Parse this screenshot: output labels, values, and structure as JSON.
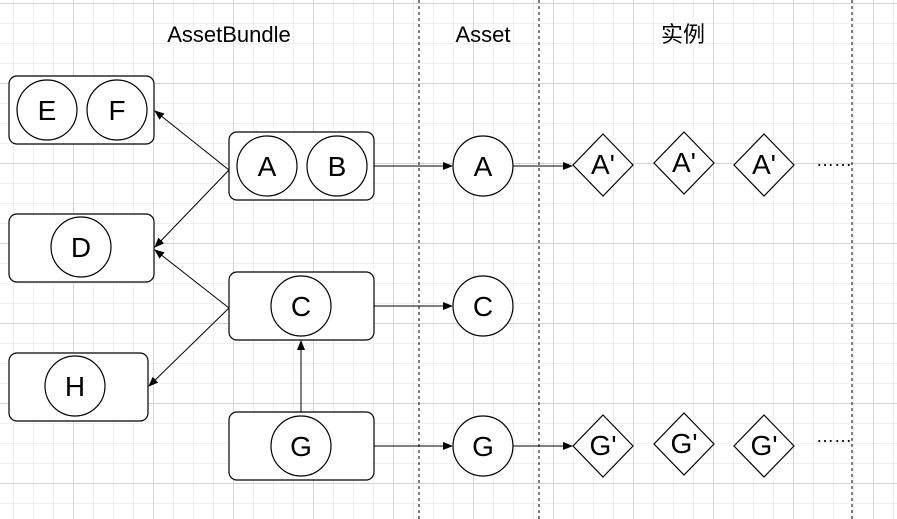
{
  "columns": {
    "assetbundle": "AssetBundle",
    "asset": "Asset",
    "instance": "实例"
  },
  "bundles": {
    "ef": {
      "items": [
        "E",
        "F"
      ]
    },
    "ab": {
      "items": [
        "A",
        "B"
      ]
    },
    "d": {
      "items": [
        "D"
      ]
    },
    "c": {
      "items": [
        "C"
      ]
    },
    "h": {
      "items": [
        "H"
      ]
    },
    "g": {
      "items": [
        "G"
      ]
    }
  },
  "assets": {
    "a": "A",
    "c": "C",
    "g": "G"
  },
  "instances": {
    "a": [
      "A'",
      "A'",
      "A'"
    ],
    "g": [
      "G'",
      "G'",
      "G'"
    ],
    "ellipsis_a": "……",
    "ellipsis_g": "……"
  }
}
